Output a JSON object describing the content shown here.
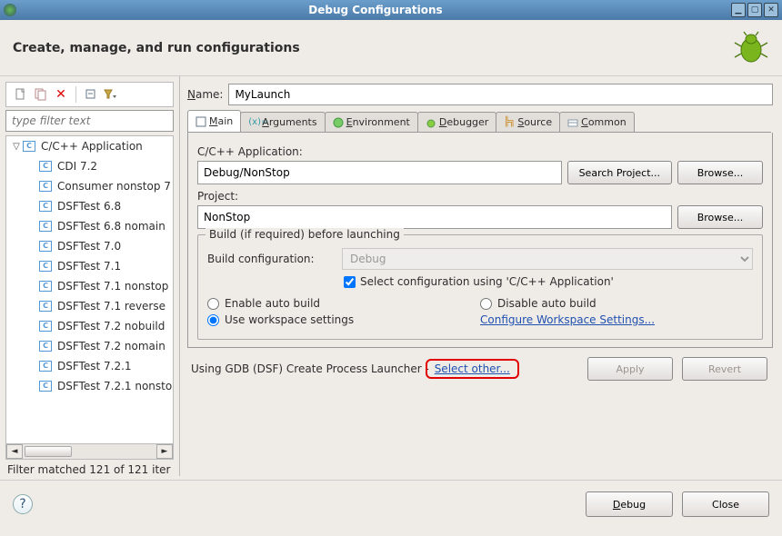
{
  "window": {
    "title": "Debug Configurations"
  },
  "header": {
    "text": "Create, manage, and run configurations"
  },
  "left": {
    "filter_placeholder": "type filter text",
    "tree_root": "C/C++ Application",
    "tree_children": [
      "CDI 7.2",
      "Consumer nonstop 7",
      "DSFTest 6.8",
      "DSFTest 6.8 nomain",
      "DSFTest 7.0",
      "DSFTest 7.1",
      "DSFTest 7.1 nonstop",
      "DSFTest 7.1 reverse",
      "DSFTest 7.2 nobuild",
      "DSFTest 7.2 nomain",
      "DSFTest 7.2.1",
      "DSFTest 7.2.1 nonsto"
    ],
    "filter_status": "Filter matched 121 of 121 iter"
  },
  "right": {
    "name_label": "Name:",
    "name_value": "MyLaunch",
    "tabs": [
      {
        "label": "Main",
        "mn": "M"
      },
      {
        "label": "Arguments",
        "mn": "A"
      },
      {
        "label": "Environment",
        "mn": "E"
      },
      {
        "label": "Debugger",
        "mn": "D"
      },
      {
        "label": "Source",
        "mn": "S"
      },
      {
        "label": "Common",
        "mn": "C"
      }
    ],
    "app_label": "C/C++ Application:",
    "app_value": "Debug/NonStop",
    "search_project_btn": "Search Project...",
    "browse_btn": "Browse...",
    "project_label": "Project:",
    "project_value": "NonStop",
    "build_legend": "Build (if required) before launching",
    "build_config_label": "Build configuration:",
    "build_config_value": "Debug",
    "select_config_checkbox": "Select configuration using 'C/C++ Application'",
    "enable_auto": "Enable auto build",
    "disable_auto": "Disable auto build",
    "use_workspace": "Use workspace settings",
    "config_workspace_link": "Configure Workspace Settings...",
    "launcher_text": "Using GDB (DSF) Create Process Launcher - ",
    "select_other": "Select other...",
    "apply_btn": "Apply",
    "revert_btn": "Revert"
  },
  "footer": {
    "debug_btn": "Debug",
    "close_btn": "Close"
  }
}
